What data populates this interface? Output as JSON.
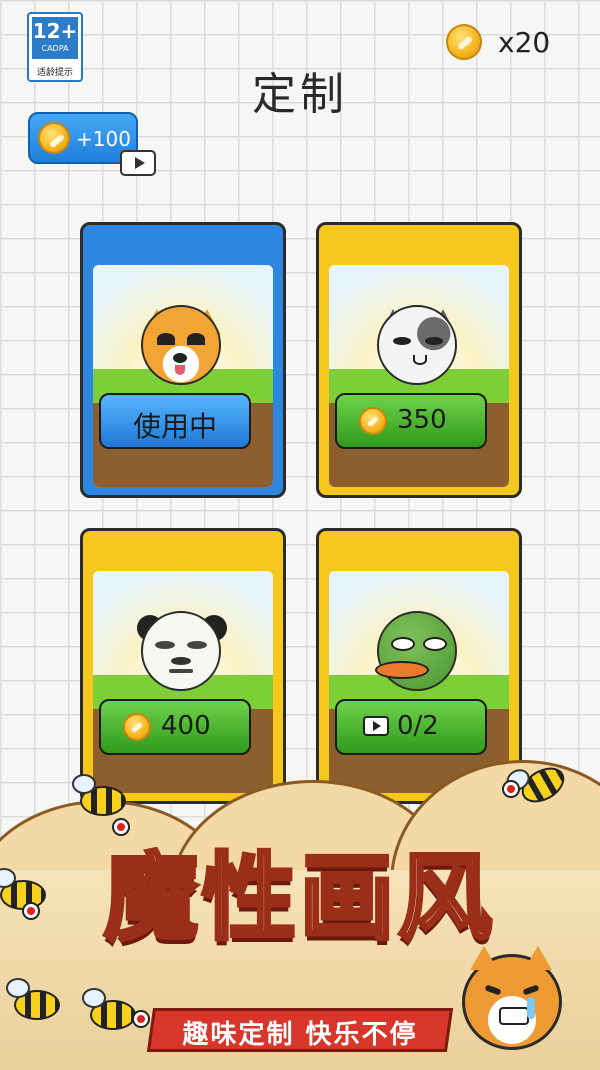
{
  "age_rating": {
    "label": "12+",
    "org": "CADPA",
    "note": "适龄提示"
  },
  "header": {
    "title": "定制",
    "coins": "x20"
  },
  "ad_reward": {
    "label": "+100"
  },
  "skins": [
    {
      "name": "shiba",
      "button": "使用中",
      "state": "in-use",
      "color": "blue"
    },
    {
      "name": "cat",
      "button": "350",
      "state": "buy-coins",
      "color": "yellow"
    },
    {
      "name": "panda",
      "button": "400",
      "state": "buy-coins",
      "color": "yellow"
    },
    {
      "name": "frog",
      "button": "0/2",
      "state": "watch-ads",
      "color": "yellow"
    }
  ],
  "banner": {
    "slogan": "魔性画风",
    "subtitle": "趣味定制  快乐不停"
  },
  "colors": {
    "blue": "#2d86e0",
    "yellow": "#f6c81e",
    "green": "#45b52a",
    "slogan_stroke": "#9b2e18",
    "ribbon": "#d8362a"
  }
}
